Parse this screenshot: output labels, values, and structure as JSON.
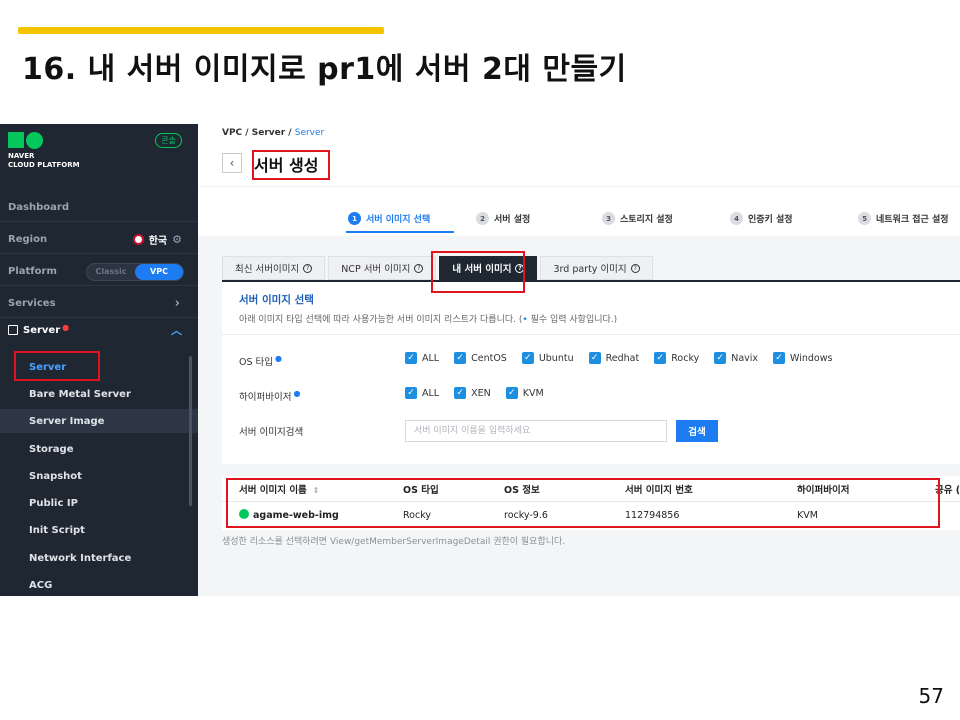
{
  "slide": {
    "title": "16. 내 서버 이미지로 pr1에 서버 2대 만들기",
    "page_number": "57",
    "accent_color": "#f5c400"
  },
  "sidebar": {
    "logo_line1": "NAVER",
    "logo_line2": "CLOUD PLATFORM",
    "console_badge": "콘솔",
    "dashboard": "Dashboard",
    "region_label": "Region",
    "region_value": "한국",
    "platform_label": "Platform",
    "platform_options": [
      "Classic",
      "VPC"
    ],
    "platform_selected": "VPC",
    "services_label": "Services",
    "server_group": "Server",
    "items": [
      {
        "label": "Server"
      },
      {
        "label": "Bare Metal Server"
      },
      {
        "label": "Server Image"
      },
      {
        "label": "Storage"
      },
      {
        "label": "Snapshot"
      },
      {
        "label": "Public IP"
      },
      {
        "label": "Init Script"
      },
      {
        "label": "Network Interface"
      },
      {
        "label": "ACG"
      }
    ]
  },
  "header": {
    "breadcrumb": [
      "VPC",
      "Server",
      "Server"
    ],
    "title": "서버 생성"
  },
  "steps": [
    {
      "num": "1",
      "label": "서버 이미지 선택"
    },
    {
      "num": "2",
      "label": "서버 설정"
    },
    {
      "num": "3",
      "label": "스토리지 설정"
    },
    {
      "num": "4",
      "label": "인증키 설정"
    },
    {
      "num": "5",
      "label": "네트워크 접근 설정"
    }
  ],
  "tabs": [
    {
      "label": "최신 서버이미지"
    },
    {
      "label": "NCP 서버 이미지"
    },
    {
      "label": "내 서버 이미지"
    },
    {
      "label": "3rd party 이미지"
    }
  ],
  "form": {
    "section_title": "서버 이미지 선택",
    "description_pre": "아래 이미지 타입 선택에 따라 사용가능한 서버 이미지 리스트가 다릅니다. (",
    "description_mark": "•",
    "description_post": " 필수 입력 사항입니다.)",
    "os_type_label": "OS 타입",
    "os_types": [
      "ALL",
      "CentOS",
      "Ubuntu",
      "Redhat",
      "Rocky",
      "Navix",
      "Windows"
    ],
    "hypervisor_label": "하이퍼바이저",
    "hypervisors": [
      "ALL",
      "XEN",
      "KVM"
    ],
    "search_label": "서버 이미지검색",
    "search_placeholder": "서버 이미지 이름을 입력하세요",
    "search_button": "검색"
  },
  "table": {
    "columns": [
      "서버 이미지 이름",
      "OS 타입",
      "OS 정보",
      "서버 이미지 번호",
      "하이퍼바이저",
      "공유 ("
    ],
    "rows": [
      {
        "name": "agame-web-img",
        "os_type": "Rocky",
        "os_info": "rocky-9.6",
        "image_no": "112794856",
        "hypervisor": "KVM"
      }
    ],
    "footnote": "생성한 리소스를 선택하려면 View/getMemberServerImageDetail 권한이 필요합니다."
  }
}
